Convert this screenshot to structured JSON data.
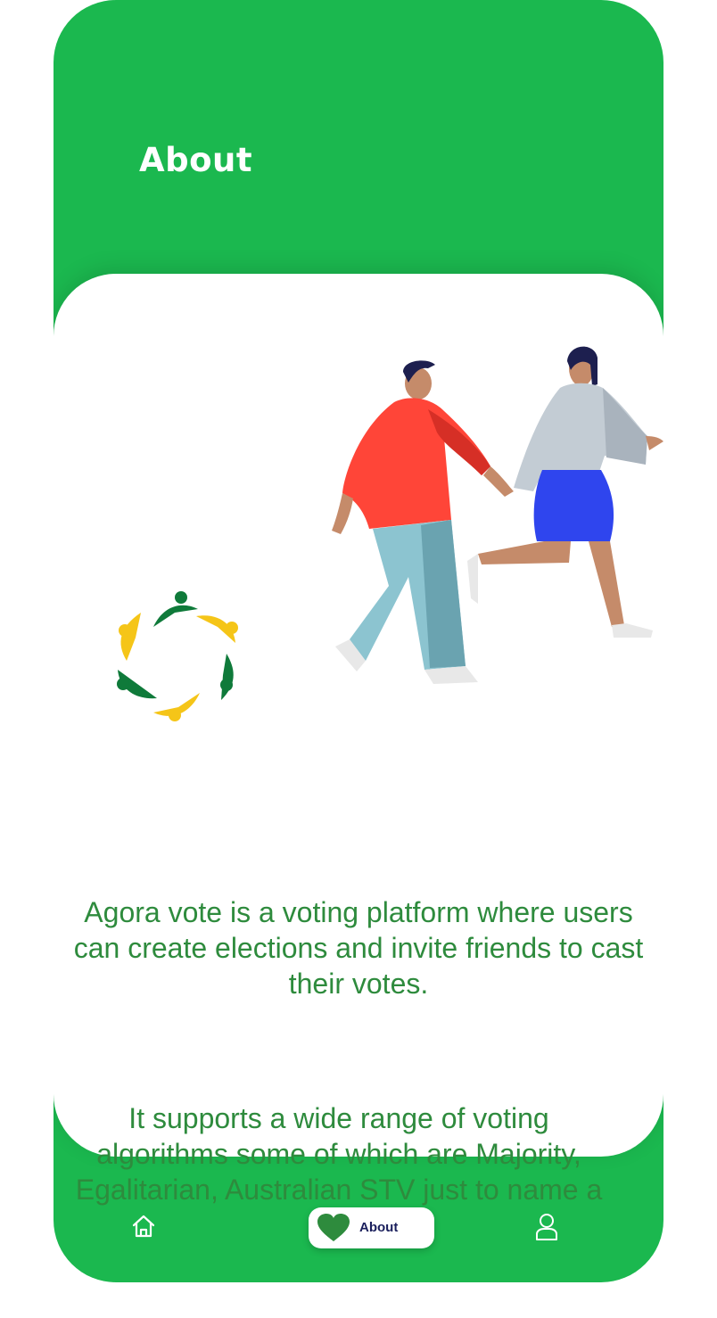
{
  "header": {
    "title": "About"
  },
  "content": {
    "paragraph_1": "Agora vote is a voting platform where users can create elections and invite friends to cast their votes.",
    "paragraph_2": "It supports a wide range of voting algorithms some of which are Majority, Egalitarian, Australian STV just to name a few"
  },
  "bottom_nav": {
    "items": [
      {
        "icon": "home-icon",
        "label": ""
      },
      {
        "icon": "heart-icon",
        "label": "About",
        "active": true
      },
      {
        "icon": "user-icon",
        "label": ""
      }
    ]
  },
  "colors": {
    "brand_green": "#1bb84f",
    "text_green": "#2e8b3d",
    "logo_dark_green": "#0f7a3a",
    "logo_yellow": "#f5c518",
    "nav_label": "#1a1f5c"
  }
}
